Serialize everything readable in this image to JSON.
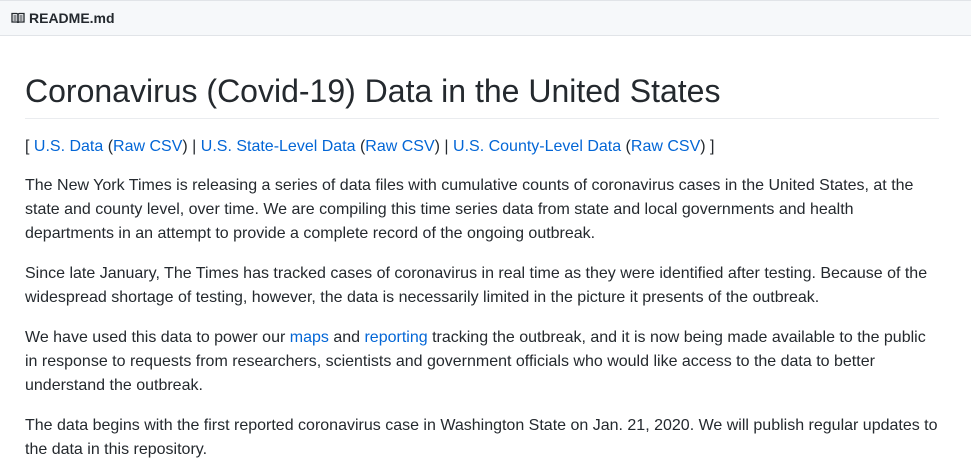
{
  "file_header": {
    "icon": "book-icon",
    "filename": "README.md"
  },
  "readme": {
    "title": "Coronavirus (Covid-19) Data in the United States",
    "links": {
      "us_data": "U.S. Data",
      "us_raw_csv": "Raw CSV",
      "state_data": "U.S. State-Level Data",
      "state_raw_csv": "Raw CSV",
      "county_data": "U.S. County-Level Data",
      "county_raw_csv": "Raw CSV"
    },
    "paragraph1": "The New York Times is releasing a series of data files with cumulative counts of coronavirus cases in the United States, at the state and county level, over time. We are compiling this time series data from state and local governments and health departments in an attempt to provide a complete record of the ongoing outbreak.",
    "paragraph2": "Since late January, The Times has tracked cases of coronavirus in real time as they were identified after testing. Because of the widespread shortage of testing, however, the data is necessarily limited in the picture it presents of the outbreak.",
    "paragraph3": {
      "text_before": "We have used this data to power our ",
      "maps_link": "maps",
      "text_and": " and ",
      "reporting_link": "reporting",
      "text_after": " tracking the outbreak, and it is now being made available to the public in response to requests from researchers, scientists and government officials who would like access to the data to better understand the outbreak."
    },
    "paragraph4": "The data begins with the first reported coronavirus case in Washington State on Jan. 21, 2020. We will publish regular updates to the data in this repository."
  },
  "colors": {
    "link": "#0366d6",
    "text": "#24292e",
    "header_bg": "#f6f8fa"
  }
}
